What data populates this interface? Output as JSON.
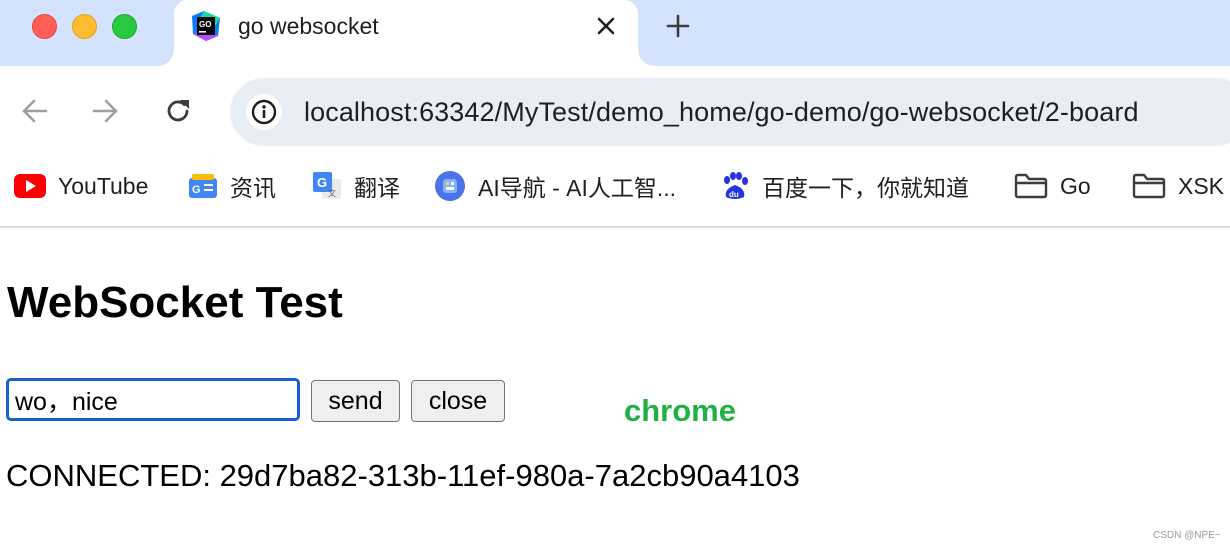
{
  "window": {
    "controls": [
      "close",
      "minimize",
      "maximize"
    ]
  },
  "tab": {
    "title": "go websocket",
    "favicon": "goland-icon"
  },
  "toolbar": {
    "url": "localhost:63342/MyTest/demo_home/go-demo/go-websocket/2-board"
  },
  "bookmarks": [
    {
      "label": "YouTube",
      "icon": "youtube-icon"
    },
    {
      "label": "资讯",
      "icon": "news-icon"
    },
    {
      "label": "翻译",
      "icon": "translate-icon"
    },
    {
      "label": "AI导航 - AI人工智...",
      "icon": "ai-nav-icon"
    },
    {
      "label": "百度一下，你就知道",
      "icon": "baidu-icon"
    },
    {
      "label": "Go",
      "icon": "folder-icon"
    },
    {
      "label": "XSK",
      "icon": "folder-icon"
    }
  ],
  "page": {
    "title": "WebSocket Test",
    "message_input": {
      "value": "wo，nice"
    },
    "send_label": "send",
    "close_label": "close",
    "annotation": "chrome",
    "status": "CONNECTED: 29d7ba82-313b-11ef-980a-7a2cb90a4103",
    "watermark": "CSDN @NPE~"
  },
  "colors": {
    "tabstrip": "#d3e3fd",
    "omnibox": "#e9eef6",
    "input_focus": "#1a5fd1",
    "annotation": "#1fb243"
  }
}
